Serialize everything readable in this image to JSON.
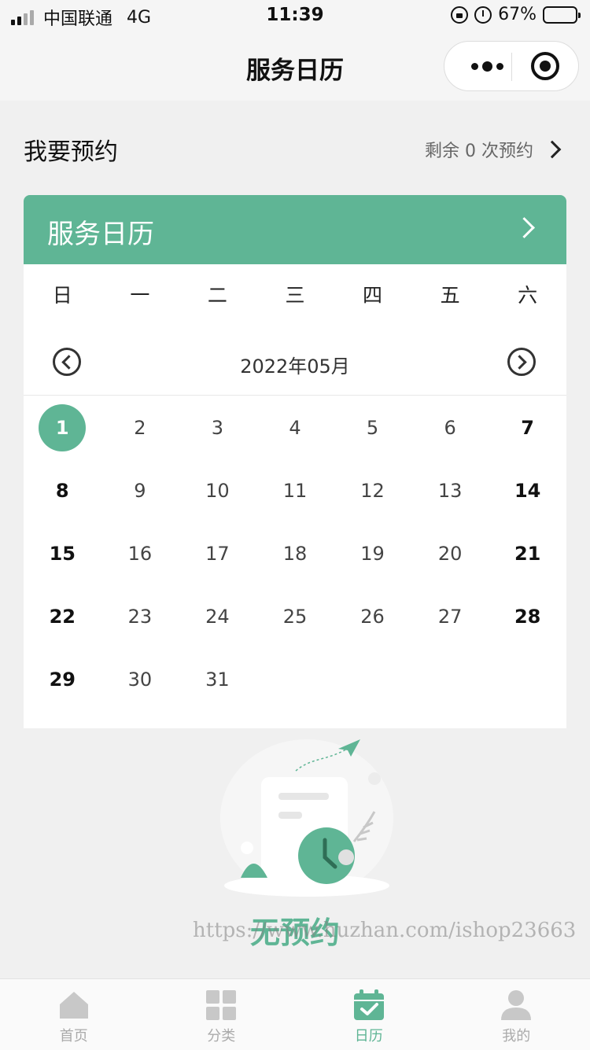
{
  "status_bar": {
    "carrier": "中国联通",
    "network": "4G",
    "time": "11:39",
    "battery": "67%",
    "battery_level": 0.67
  },
  "nav": {
    "title": "服务日历"
  },
  "booking": {
    "title": "我要预约",
    "remaining": "剩余 0 次预约"
  },
  "calendar": {
    "header_title": "服务日历",
    "weekdays": [
      "日",
      "一",
      "二",
      "三",
      "四",
      "五",
      "六"
    ],
    "month_label": "2022年05月",
    "selected_day": "1",
    "weeks": [
      [
        "1",
        "2",
        "3",
        "4",
        "5",
        "6",
        "7"
      ],
      [
        "8",
        "9",
        "10",
        "11",
        "12",
        "13",
        "14"
      ],
      [
        "15",
        "16",
        "17",
        "18",
        "19",
        "20",
        "21"
      ],
      [
        "22",
        "23",
        "24",
        "25",
        "26",
        "27",
        "28"
      ],
      [
        "29",
        "30",
        "31",
        "",
        "",
        "",
        ""
      ]
    ]
  },
  "empty": {
    "text": "无预约"
  },
  "watermark": "https://www.huzhan.com/ishop23663",
  "tabbar": {
    "items": [
      {
        "label": "首页",
        "icon": "home-icon"
      },
      {
        "label": "分类",
        "icon": "grid-icon"
      },
      {
        "label": "日历",
        "icon": "calendar-icon"
      },
      {
        "label": "我的",
        "icon": "user-icon"
      }
    ],
    "active_index": 2
  },
  "colors": {
    "accent": "#5fb595",
    "inactive": "#c8c8c8",
    "background": "#f0f0f0"
  }
}
